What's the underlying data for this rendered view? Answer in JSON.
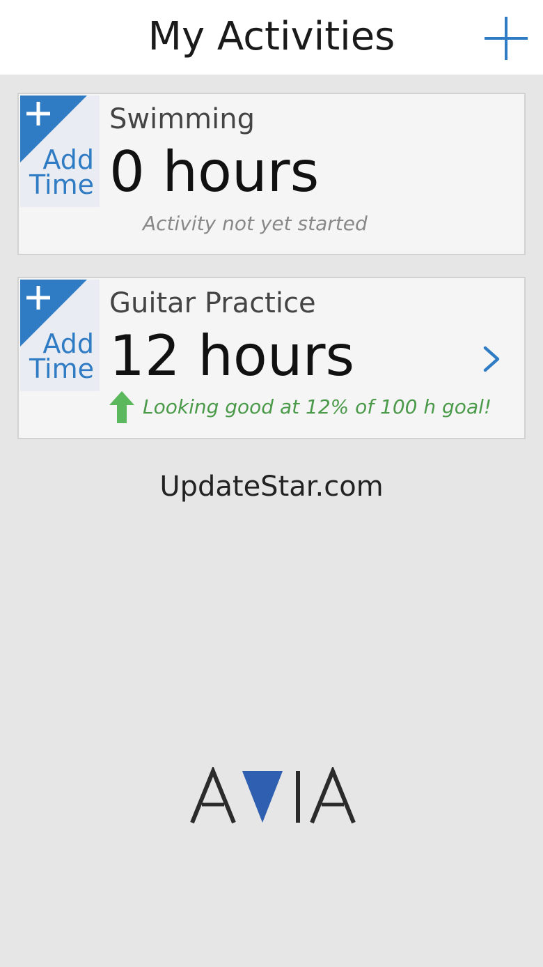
{
  "header": {
    "title": "My Activities",
    "add_icon": "plus-icon"
  },
  "colors": {
    "accent": "#2f7cc5",
    "goal_green": "#4a9a4a",
    "background": "#e6e6e6"
  },
  "activities": [
    {
      "add_time_line1": "Add",
      "add_time_line2": "Time",
      "name": "Swimming",
      "hours": "0 hours",
      "status": "Activity not yet started"
    },
    {
      "add_time_line1": "Add",
      "add_time_line2": "Time",
      "name": "Guitar Practice",
      "hours": "12 hours",
      "status": "Looking good at 12% of 100 h goal!",
      "status_icon": "arrow-up-icon",
      "detail_icon": "chevron-right-icon"
    }
  ],
  "watermark": "UpdateStar.com",
  "logo": "AVIA"
}
